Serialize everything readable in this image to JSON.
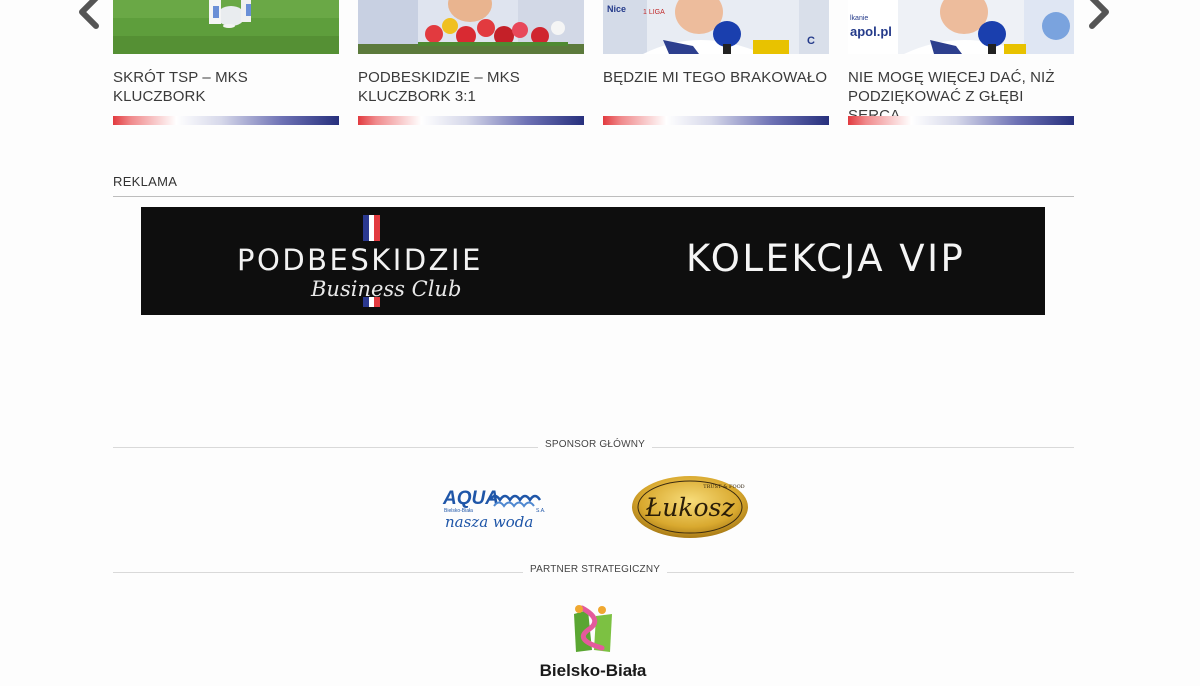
{
  "carousel": {
    "items": [
      {
        "title": "SKRÓT TSP – MKS KLUCZBORK"
      },
      {
        "title": "PODBESKIDZIE – MKS KLUCZBORK 3:1"
      },
      {
        "title": "BĘDZIE MI TEGO BRAKOWAŁO"
      },
      {
        "title": "NIE MOGĘ WIĘCEJ DAĆ, NIŻ PODZIĘKOWAĆ Z GŁĘBI SERCA"
      }
    ],
    "thumb_text": {
      "mic_sign": "apol.pl",
      "board_text": "Nice",
      "board_text2": "1 LIGA",
      "sign_partial": "lkanie"
    }
  },
  "ad": {
    "label": "REKLAMA",
    "banner_brand": "PODBESKIDZIE",
    "banner_club": "Business Club",
    "banner_right": "KOLEKCJA VIP"
  },
  "sponsors": {
    "main_label": "SPONSOR GŁÓWNY",
    "aqua_name": "AQUA",
    "aqua_sub": "Bielsko-Biała",
    "aqua_sa": "S.A.",
    "aqua_slogan": "nasza woda",
    "lukosz_name": "Łukosz",
    "lukosz_tag": "TRUST & FOOD",
    "partner_label": "PARTNER STRATEGICZNY",
    "city_name": "Bielsko-Biała"
  },
  "colors": {
    "red": "#e23a3f",
    "navy": "#27307d",
    "gold": "#d9a92f"
  }
}
